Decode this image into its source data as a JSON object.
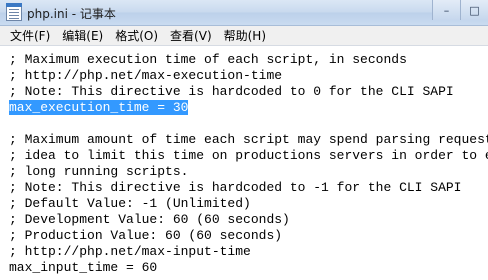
{
  "window": {
    "title": "php.ini - 记事本",
    "buttons": {
      "minimize": "–",
      "maximize": "□",
      "close": "✕"
    }
  },
  "menu": [
    {
      "label": "文件(F)"
    },
    {
      "label": "编辑(E)"
    },
    {
      "label": "格式(O)"
    },
    {
      "label": "查看(V)"
    },
    {
      "label": "帮助(H)"
    }
  ],
  "editor": {
    "lines": [
      "; Maximum execution time of each script, in seconds",
      "; http://php.net/max-execution-time",
      "; Note: This directive is hardcoded to 0 for the CLI SAPI",
      "max_execution_time = 30",
      "",
      "; Maximum amount of time each script may spend parsing request data. It's a good",
      "; idea to limit this time on productions servers in order to eliminate unexpectedly",
      "; long running scripts.",
      "; Note: This directive is hardcoded to -1 for the CLI SAPI",
      "; Default Value: -1 (Unlimited)",
      "; Development Value: 60 (60 seconds)",
      "; Production Value: 60 (60 seconds)",
      "; http://php.net/max-input-time",
      "max_input_time = 60"
    ],
    "selected_line_index": 3
  }
}
